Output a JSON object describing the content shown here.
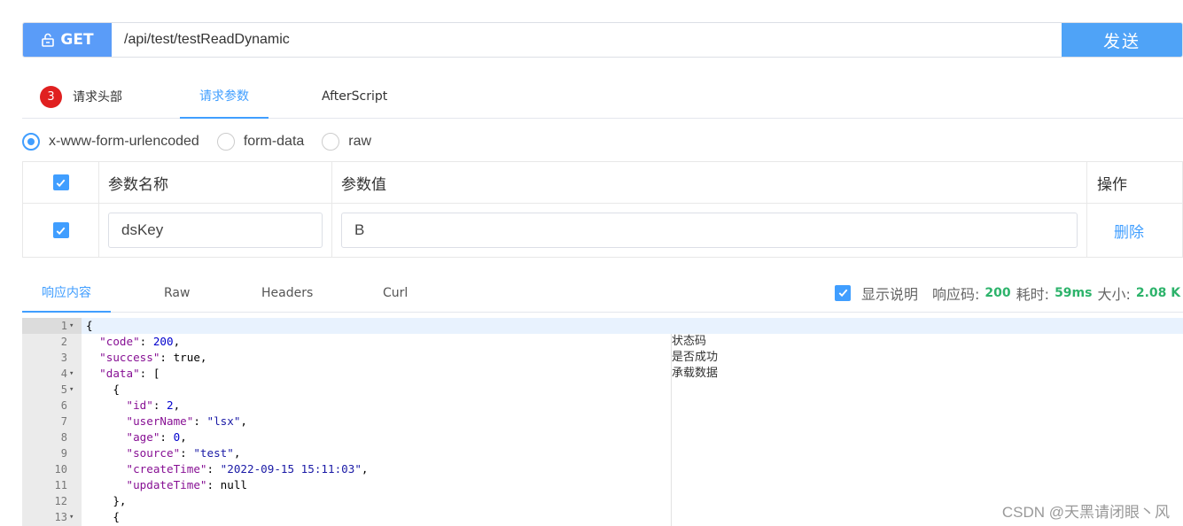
{
  "request": {
    "method": "GET",
    "url": "/api/test/testReadDynamic",
    "send_label": "发送"
  },
  "req_tabs": {
    "headers_count": "3",
    "headers_label": "请求头部",
    "params_label": "请求参数",
    "afterscript_label": "AfterScript"
  },
  "body_types": {
    "urlencoded": "x-www-form-urlencoded",
    "formdata": "form-data",
    "raw": "raw",
    "selected": "x-www-form-urlencoded"
  },
  "params_table": {
    "col_name": "参数名称",
    "col_value": "参数值",
    "col_action": "操作",
    "rows": [
      {
        "name": "dsKey",
        "value": "B",
        "action": "删除",
        "checked": true
      }
    ]
  },
  "resp_tabs": {
    "content": "响应内容",
    "raw": "Raw",
    "headers": "Headers",
    "curl": "Curl"
  },
  "resp_meta": {
    "show_desc": "显示说明",
    "code_label": "响应码:",
    "code": "200",
    "time_label": "耗时:",
    "time": "59ms",
    "size_label": "大小:",
    "size": "2.08 K"
  },
  "editor": {
    "line_numbers": [
      "1",
      "2",
      "3",
      "4",
      "5",
      "6",
      "7",
      "8",
      "9",
      "10",
      "11",
      "12",
      "13"
    ],
    "notes": [
      "状态码",
      "是否成功",
      "承载数据"
    ]
  },
  "watermark": "CSDN @天黑请闭眼丶风",
  "colors": {
    "accent": "#409eff",
    "method_bg": "#5a9cf8",
    "green": "#2db36b",
    "badge": "#e02020"
  }
}
